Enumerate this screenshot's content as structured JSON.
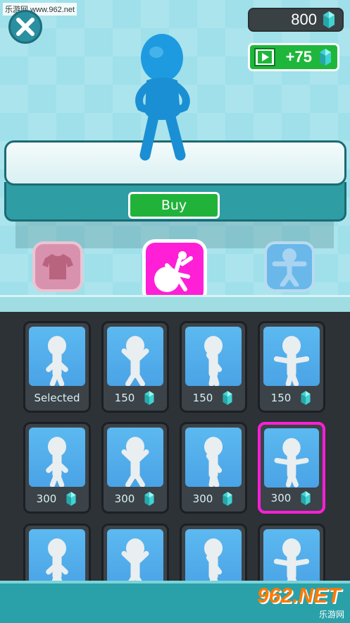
{
  "watermark": "乐游网 www.962.net",
  "top_bar": {
    "gem_count": "800",
    "ad_reward": "+75",
    "close_icon": "close-icon",
    "video_icon": "film-play-icon",
    "gem_icon": "diamond-gem-icon"
  },
  "showroom": {
    "buy_label": "Buy",
    "character_color": "#1e9be0"
  },
  "categories": [
    {
      "name": "outfit",
      "icon": "tshirt-icon",
      "active": false
    },
    {
      "name": "dance",
      "icon": "dancer-icon",
      "active": true
    },
    {
      "name": "skin",
      "icon": "character-icon",
      "active": false
    }
  ],
  "items": [
    {
      "label": "Selected",
      "price": null
    },
    {
      "label": "150",
      "price": 150
    },
    {
      "label": "150",
      "price": 150
    },
    {
      "label": "150",
      "price": 150
    },
    {
      "label": "300",
      "price": 300
    },
    {
      "label": "300",
      "price": 300
    },
    {
      "label": "300",
      "price": 300
    },
    {
      "label": "300",
      "price": 300,
      "highlighted": true
    },
    {
      "label": "",
      "price": null
    },
    {
      "label": "",
      "price": null
    },
    {
      "label": "",
      "price": null
    },
    {
      "label": "",
      "price": null
    }
  ],
  "brand": {
    "logo": "962.NET",
    "subtitle": "乐游网"
  },
  "colors": {
    "accent_magenta": "#ff1fd6",
    "buy_green": "#21b23a",
    "teal": "#2aa1a8"
  }
}
